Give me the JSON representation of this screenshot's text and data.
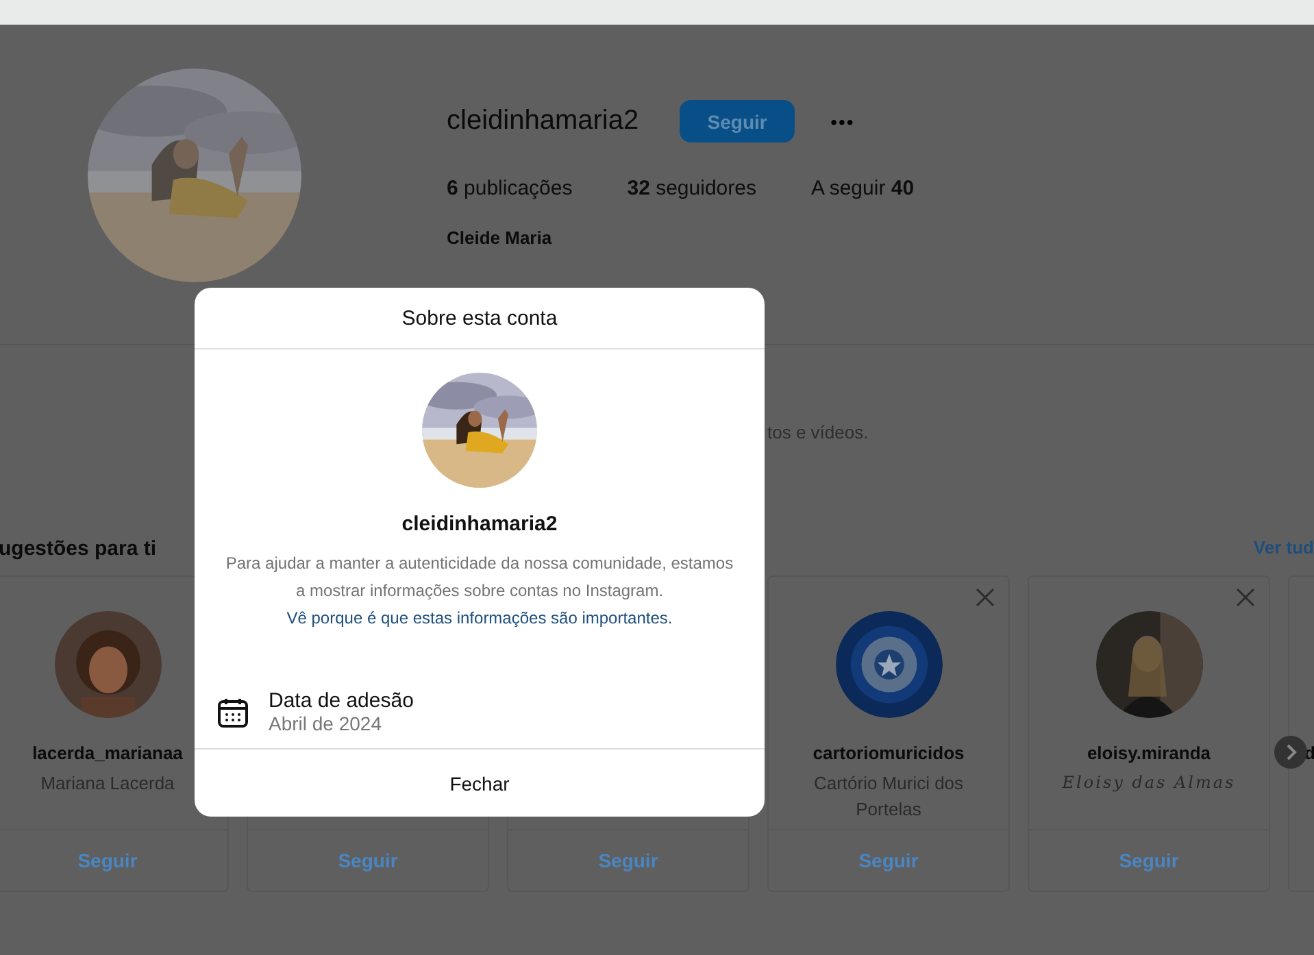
{
  "profile": {
    "username": "cleidinhamaria2",
    "follow_button": "Seguir",
    "more_button": "•••",
    "stats": [
      {
        "text": "**6** publicações"
      },
      {
        "text": "**32** seguidores"
      },
      {
        "text": "A seguir **40**"
      }
    ],
    "name": "Cleide Maria"
  },
  "background_text": "tos e vídeos.",
  "suggestions": {
    "title": "ugestões para ti",
    "see_all": "Ver tud",
    "cards": [
      {
        "kind": "full",
        "username": "lacerda_marianaa",
        "full_name": "Mariana Lacerda",
        "follow": "Seguir"
      },
      {
        "kind": "covered",
        "follow": "Seguir"
      },
      {
        "kind": "covered",
        "follow": "Seguir"
      },
      {
        "kind": "full",
        "username": "cartoriomuricidos",
        "full_name": "Cartório Murici dos Portelas",
        "dismissible": true,
        "follow": "Seguir"
      },
      {
        "kind": "full",
        "username": "eloisy.miranda",
        "full_name": "Eloisy das Almas",
        "fancy_name": true,
        "dismissible": true,
        "follow": "Seguir"
      },
      {
        "kind": "partial",
        "username": "d"
      }
    ]
  },
  "modal": {
    "title": "Sobre esta conta",
    "username": "cleidinhamaria2",
    "notice": "Para ajudar a manter a autenticidade da nossa comunidade, estamos a mostrar informações sobre contas no Instagram.",
    "link": "Vê porque é que estas informações são importantes.",
    "details": [
      {
        "label": "Data de adesão",
        "value": "Abril de 2024"
      }
    ],
    "close": "Fechar"
  }
}
